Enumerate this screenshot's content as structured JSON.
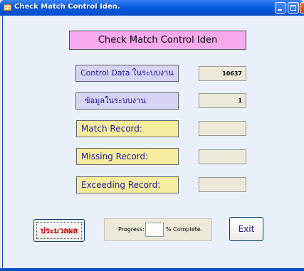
{
  "window": {
    "title": "Check Match Control Iden.",
    "icon": "app-icon",
    "controls": [
      "minimize-icon",
      "maximize-icon",
      "close-icon"
    ]
  },
  "heading": "Check Match Control Iden",
  "rows": [
    {
      "label": "Control Data ในระบบงาน",
      "value": "10637"
    },
    {
      "label": "ข้อมูลในระบบงาน",
      "value": "1"
    },
    {
      "label": "Match Record:",
      "value": ""
    },
    {
      "label": "Missing Record:",
      "value": ""
    },
    {
      "label": "Exceeding Record:",
      "value": ""
    }
  ],
  "process_button": "ประมวลผล",
  "progress": {
    "label": "Progress:",
    "value": "",
    "suffix": "% Complete."
  },
  "exit_button": "Exit",
  "colors": {
    "titlebar": "#0a5fe0",
    "heading_bg": "#f7a9ee",
    "lavender_label": "#d7d3f2",
    "yellow_label": "#f6ec9e",
    "label_text": "#1a1a9e",
    "process_text": "#cc0000",
    "client_bg": "#eaf0f9"
  }
}
